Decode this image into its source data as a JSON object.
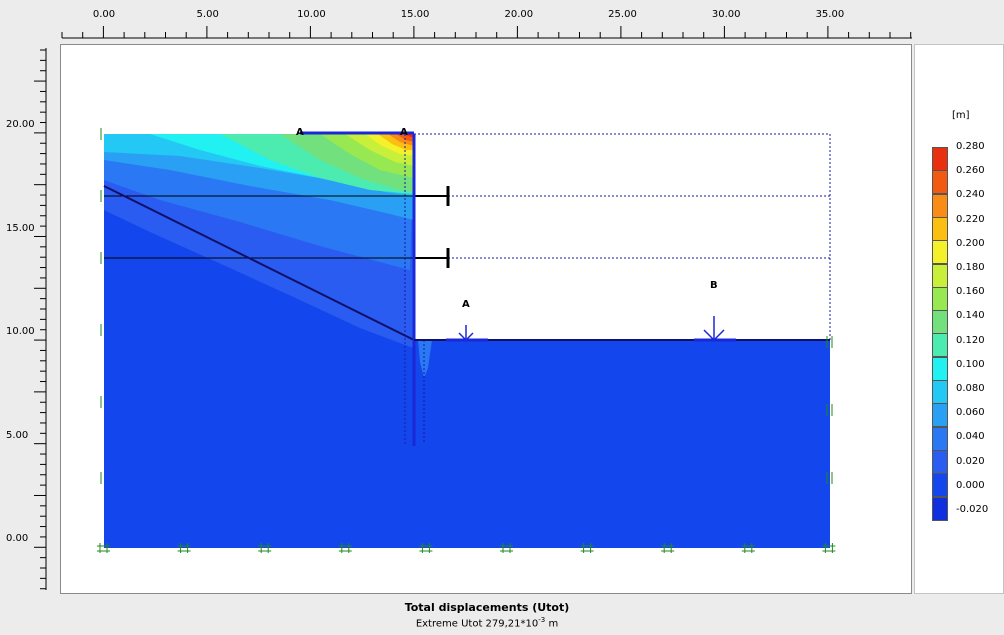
{
  "x_axis": {
    "ticks": [
      "0.00",
      "5.00",
      "10.00",
      "15.00",
      "20.00",
      "25.00",
      "30.00",
      "35.00"
    ]
  },
  "y_axis": {
    "ticks": [
      "20.00",
      "15.00",
      "10.00",
      "5.00",
      "0.00"
    ]
  },
  "legend": {
    "unit": "[m]",
    "levels": [
      "0.280",
      "0.260",
      "0.240",
      "0.220",
      "0.200",
      "0.180",
      "0.160",
      "0.140",
      "0.120",
      "0.100",
      "0.080",
      "0.060",
      "0.040",
      "0.020",
      "0.000",
      "-0.020"
    ],
    "colors": [
      "#e83010",
      "#f25a12",
      "#f88c16",
      "#fbbf14",
      "#f4f12a",
      "#c8ef3a",
      "#98e852",
      "#72e07c",
      "#4cebb0",
      "#22f1f1",
      "#24c8f4",
      "#2aa0f4",
      "#2a78f4",
      "#2a5cf2",
      "#1446ee",
      "#1030e0"
    ]
  },
  "markers": {
    "a_top_1": "A",
    "a_top_2": "A",
    "a": "A",
    "b": "B"
  },
  "caption": {
    "title": "Total displacements (Utot)",
    "subtitle_prefix": "Extreme Utot 279,21*10",
    "subtitle_exp": "-3",
    "subtitle_unit": "m"
  }
}
